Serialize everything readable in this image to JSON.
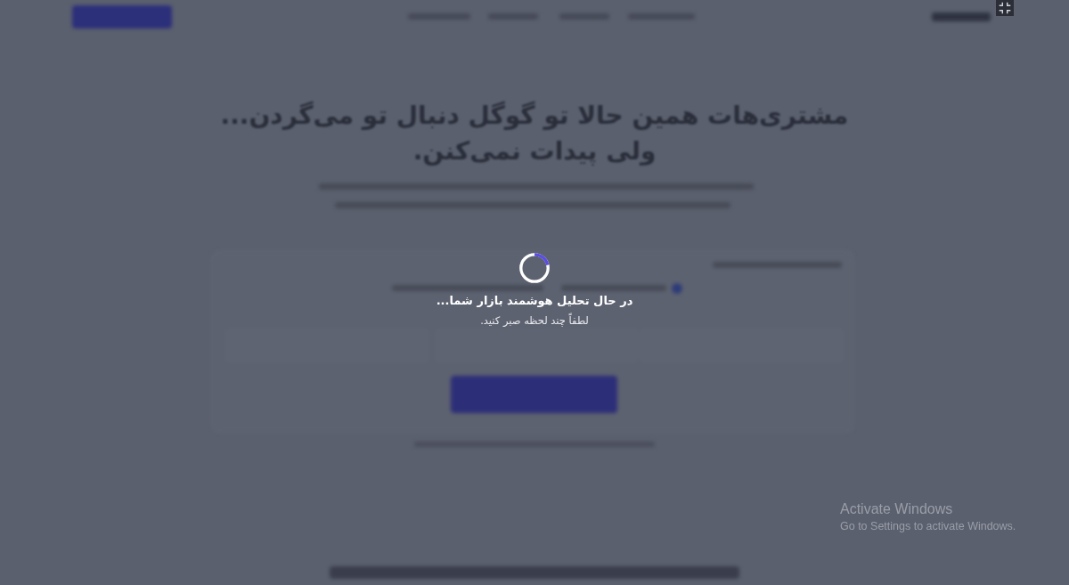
{
  "headline": [
    "مشتری‌هات همین حالا تو گوگل دنبال تو می‌گردن...",
    "ولی پیدات نمی‌کنن."
  ],
  "loading": {
    "title": "در حال تحلیل هوشمند بازار شما...",
    "message": "لطفاً چند لحظه صبر کنید."
  },
  "os_notice": {
    "title": "Activate Windows",
    "message": "Go to Settings to activate Windows."
  }
}
